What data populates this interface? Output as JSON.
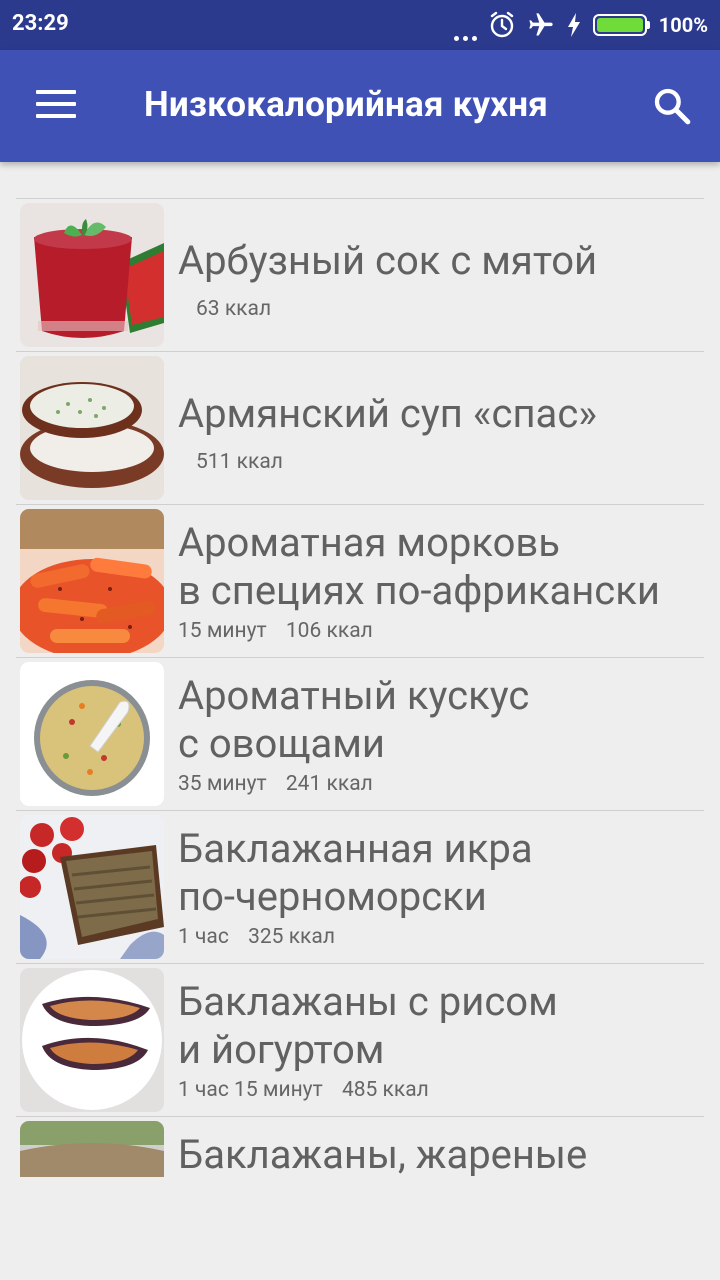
{
  "status_bar": {
    "time": "23:29",
    "battery_percent": "100%",
    "battery_level": 1.0,
    "icons": [
      "more-dots-icon",
      "alarm-icon",
      "airplane-mode-icon",
      "charging-icon",
      "battery-icon"
    ]
  },
  "app_bar": {
    "title": "Низкокалорийная кухня",
    "menu_icon": "hamburger-menu-icon",
    "search_icon": "search-icon"
  },
  "recipes": [
    {
      "title": "Арбузный сок с мятой",
      "time": "",
      "kcal": "63 ккал",
      "image": "watermelon-juice-photo"
    },
    {
      "title": "Армянский суп «спас»",
      "time": "",
      "kcal": "511 ккал",
      "image": "yogurt-soup-photo"
    },
    {
      "title": "Ароматная морковь\nв специях по-африкански",
      "time": "15 минут",
      "kcal": "106 ккал",
      "image": "spiced-carrots-photo"
    },
    {
      "title": "Ароматный кускус\nс овощами",
      "time": "35 минут",
      "kcal": "241 ккал",
      "image": "couscous-photo"
    },
    {
      "title": "Баклажанная икра\nпо-черноморски",
      "time": "1 час",
      "kcal": "325 ккал",
      "image": "eggplant-caviar-photo"
    },
    {
      "title": "Баклажаны с рисом\nи йогуртом",
      "time": "1 час 15 минут",
      "kcal": "485 ккал",
      "image": "stuffed-eggplant-photo"
    },
    {
      "title": "Баклажаны, жареные",
      "time": "",
      "kcal": "",
      "image": "fried-eggplant-photo"
    }
  ]
}
